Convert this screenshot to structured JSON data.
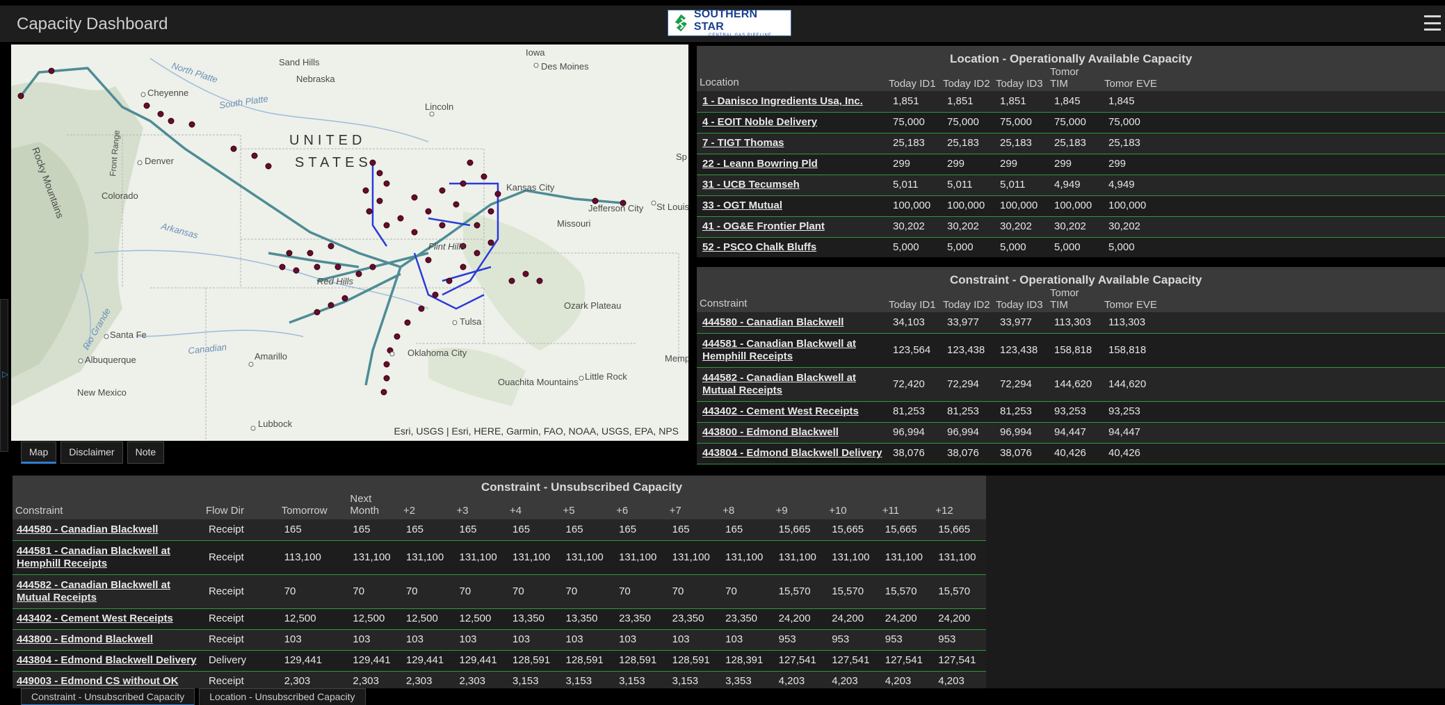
{
  "header": {
    "title": "Capacity Dashboard",
    "logo_name": "SOUTHERN STAR",
    "logo_sub": "CENTRAL GAS PIPELINE"
  },
  "map": {
    "attribution": "Esri, USGS | Esri, HERE, Garmin, FAO, NOAA, USGS, EPA, NPS",
    "labels": [
      "Iowa",
      "Des Moines",
      "Sand Hills",
      "Nebraska",
      "Lincoln",
      "North Platte",
      "South Platte",
      "Cheyenne",
      "Denver",
      "Colorado",
      "Rocky Mountains",
      "Front Range",
      "UNITED",
      "STATES",
      "Kansas City",
      "Jefferson City",
      "St Louis",
      "Missouri",
      "Flint Hills",
      "Red Hills",
      "Arkansas",
      "Tulsa",
      "Oklahoma City",
      "Ozark Plateau",
      "Ouachita Mountains",
      "Little Rock",
      "Amarillo",
      "Canadian",
      "Santa Fe",
      "Albuquerque",
      "New Mexico",
      "Lubbock",
      "Rio Grande",
      "Memp",
      "Sp"
    ],
    "tabs": [
      "Map",
      "Disclaimer",
      "Note"
    ]
  },
  "location_oac": {
    "title": "Location - Operationally Available Capacity",
    "headers": [
      "Location",
      "Today ID1",
      "Today ID2",
      "Today ID3",
      "Tomor TIM",
      "Tomor EVE"
    ],
    "rows": [
      [
        "1 - Danisco Ingredients Usa, Inc.",
        "1,851",
        "1,851",
        "1,851",
        "1,845",
        "1,845"
      ],
      [
        "4 - EOIT Noble Delivery",
        "75,000",
        "75,000",
        "75,000",
        "75,000",
        "75,000"
      ],
      [
        "7 - TIGT Thomas",
        "25,183",
        "25,183",
        "25,183",
        "25,183",
        "25,183"
      ],
      [
        "22 - Leann Bowring Pld",
        "299",
        "299",
        "299",
        "299",
        "299"
      ],
      [
        "31 - UCB Tecumseh",
        "5,011",
        "5,011",
        "5,011",
        "4,949",
        "4,949"
      ],
      [
        "33 - OGT Mutual",
        "100,000",
        "100,000",
        "100,000",
        "100,000",
        "100,000"
      ],
      [
        "41 - OG&E Frontier Plant",
        "30,202",
        "30,202",
        "30,202",
        "30,202",
        "30,202"
      ],
      [
        "52 - PSCO Chalk Bluffs",
        "5,000",
        "5,000",
        "5,000",
        "5,000",
        "5,000"
      ]
    ]
  },
  "constraint_oac": {
    "title": "Constraint - Operationally Available Capacity",
    "headers": [
      "Constraint",
      "Today ID1",
      "Today ID2",
      "Today ID3",
      "Tomor TIM",
      "Tomor EVE"
    ],
    "rows": [
      [
        "444580 - Canadian Blackwell",
        "34,103",
        "33,977",
        "33,977",
        "113,303",
        "113,303"
      ],
      [
        "444581 - Canadian Blackwell at Hemphill Receipts",
        "123,564",
        "123,438",
        "123,438",
        "158,818",
        "158,818"
      ],
      [
        "444582 - Canadian Blackwell at Mutual Receipts",
        "72,420",
        "72,294",
        "72,294",
        "144,620",
        "144,620"
      ],
      [
        "443402 - Cement West Receipts",
        "81,253",
        "81,253",
        "81,253",
        "93,253",
        "93,253"
      ],
      [
        "443800 - Edmond Blackwell",
        "96,994",
        "96,994",
        "96,994",
        "94,447",
        "94,447"
      ],
      [
        "443804 - Edmond Blackwell Delivery",
        "38,076",
        "38,076",
        "38,076",
        "40,426",
        "40,426"
      ]
    ]
  },
  "constraint_unsub": {
    "title": "Constraint - Unsubscribed Capacity",
    "headers": [
      "Constraint",
      "Flow Dir",
      "Tomorrow",
      "Next Month",
      "+2",
      "+3",
      "+4",
      "+5",
      "+6",
      "+7",
      "+8",
      "+9",
      "+10",
      "+11",
      "+12"
    ],
    "rows": [
      [
        "444580 - Canadian Blackwell",
        "Receipt",
        "165",
        "165",
        "165",
        "165",
        "165",
        "165",
        "165",
        "165",
        "165",
        "15,665",
        "15,665",
        "15,665",
        "15,665"
      ],
      [
        "444581 - Canadian Blackwell at Hemphill Receipts",
        "Receipt",
        "113,100",
        "131,100",
        "131,100",
        "131,100",
        "131,100",
        "131,100",
        "131,100",
        "131,100",
        "131,100",
        "131,100",
        "131,100",
        "131,100",
        "131,100"
      ],
      [
        "444582 - Canadian Blackwell at Mutual Receipts",
        "Receipt",
        "70",
        "70",
        "70",
        "70",
        "70",
        "70",
        "70",
        "70",
        "70",
        "15,570",
        "15,570",
        "15,570",
        "15,570"
      ],
      [
        "443402 - Cement West Receipts",
        "Receipt",
        "12,500",
        "12,500",
        "12,500",
        "12,500",
        "13,350",
        "13,350",
        "23,350",
        "23,350",
        "23,350",
        "24,200",
        "24,200",
        "24,200",
        "24,200"
      ],
      [
        "443800 - Edmond Blackwell",
        "Receipt",
        "103",
        "103",
        "103",
        "103",
        "103",
        "103",
        "103",
        "103",
        "103",
        "953",
        "953",
        "953",
        "953"
      ],
      [
        "443804 - Edmond Blackwell Delivery",
        "Delivery",
        "129,441",
        "129,441",
        "129,441",
        "129,441",
        "128,591",
        "128,591",
        "128,591",
        "128,591",
        "128,391",
        "127,541",
        "127,541",
        "127,541",
        "127,541"
      ],
      [
        "449003 - Edmond CS without OK",
        "Receipt",
        "2,303",
        "2,303",
        "2,303",
        "2,303",
        "3,153",
        "3,153",
        "3,153",
        "3,153",
        "3,353",
        "4,203",
        "4,203",
        "4,203",
        "4,203"
      ]
    ]
  },
  "bottom_tabs": [
    "Constraint - Unsubscribed Capacity",
    "Location - Unsubscribed Capacity"
  ]
}
